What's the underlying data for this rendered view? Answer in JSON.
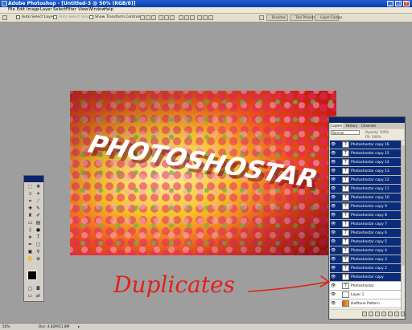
{
  "window": {
    "title": "Adobe Photoshop - [Untitled-3 @ 50% (RGB/8)]"
  },
  "menu": [
    "File",
    "Edit",
    "Image",
    "Layer",
    "Select",
    "Filter",
    "View",
    "Window",
    "Help"
  ],
  "options_bar": {
    "auto_select_layer": "Auto Select Layer",
    "auto_select_groups": "Auto Select Groups",
    "show_transform_controls": "Show Transform Controls"
  },
  "workspace_tabs": [
    "Brushes",
    "Tool Presets",
    "Layer Comps"
  ],
  "canvas": {
    "text": "PHOTOSHOSTAR"
  },
  "layers_panel": {
    "tabs": [
      "Layers",
      "History",
      "Channels"
    ],
    "blend_mode": "Normal",
    "opacity_label": "Opacity:",
    "opacity_value": "100%",
    "fill_label": "Fill:",
    "fill_value": "100%",
    "layers": [
      {
        "name": "Photoshostar copy 16",
        "selected": true
      },
      {
        "name": "Photoshostar copy 15",
        "selected": true
      },
      {
        "name": "Photoshostar copy 14",
        "selected": true
      },
      {
        "name": "Photoshostar copy 13",
        "selected": true
      },
      {
        "name": "Photoshostar copy 12",
        "selected": true
      },
      {
        "name": "Photoshostar copy 11",
        "selected": true
      },
      {
        "name": "Photoshostar copy 10",
        "selected": true
      },
      {
        "name": "Photoshostar copy 9",
        "selected": true
      },
      {
        "name": "Photoshostar copy 8",
        "selected": true
      },
      {
        "name": "Photoshostar copy 7",
        "selected": true
      },
      {
        "name": "Photoshostar copy 6",
        "selected": true
      },
      {
        "name": "Photoshostar copy 5",
        "selected": true
      },
      {
        "name": "Photoshostar copy 4",
        "selected": true
      },
      {
        "name": "Photoshostar copy 3",
        "selected": true
      },
      {
        "name": "Photoshostar copy 2",
        "selected": true
      },
      {
        "name": "Photoshostar copy",
        "selected": true
      },
      {
        "name": "Photoshostar",
        "selected": false
      },
      {
        "name": "Layer 1",
        "selected": false
      },
      {
        "name": "Halftone Pattern",
        "selected": false
      }
    ]
  },
  "annotation": {
    "text": "Duplicates"
  },
  "status_bar": {
    "zoom": "50%",
    "doc": "Doc: 4.82M/51.8M"
  },
  "colors": {
    "title_bar": "#0a3da8",
    "selection": "#0a2c7a",
    "annotation": "#e3201b"
  }
}
